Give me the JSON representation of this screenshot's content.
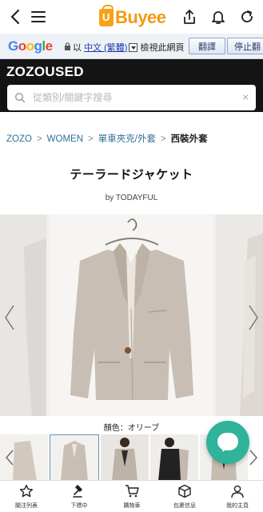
{
  "appbar": {
    "logo_text": "Buyee"
  },
  "translate_bar": {
    "google_letters": [
      "G",
      "o",
      "o",
      "g",
      "l",
      "e"
    ],
    "prefix": "以",
    "language": "中文 (繁體)",
    "suffix": "檢視此網頁",
    "translate_button": "翻譯",
    "stop_button": "停止翻"
  },
  "header": {
    "brand": "ZOZOUSED",
    "search_placeholder": "從類別/關鍵字搜尋"
  },
  "breadcrumb": {
    "items": [
      "ZOZO",
      "WOMEN",
      "單車夾克/外套"
    ],
    "current": "西裝外套",
    "separator": ">"
  },
  "product": {
    "title": "テーラードジャケット",
    "brand_line": "by TODAYFUL",
    "color_label": "顏色：オリーブ"
  },
  "tabbar": {
    "items": [
      {
        "label": "關注列表",
        "icon": "star-icon"
      },
      {
        "label": "下標中",
        "icon": "gavel-icon"
      },
      {
        "label": "購物車",
        "icon": "cart-icon"
      },
      {
        "label": "包裹信息",
        "icon": "package-icon"
      },
      {
        "label": "我的主頁",
        "icon": "person-icon"
      }
    ]
  },
  "colors": {
    "accent": "#f29a12",
    "chat": "#2fb39a",
    "header_bg": "#141414",
    "link": "#2f6f99"
  }
}
